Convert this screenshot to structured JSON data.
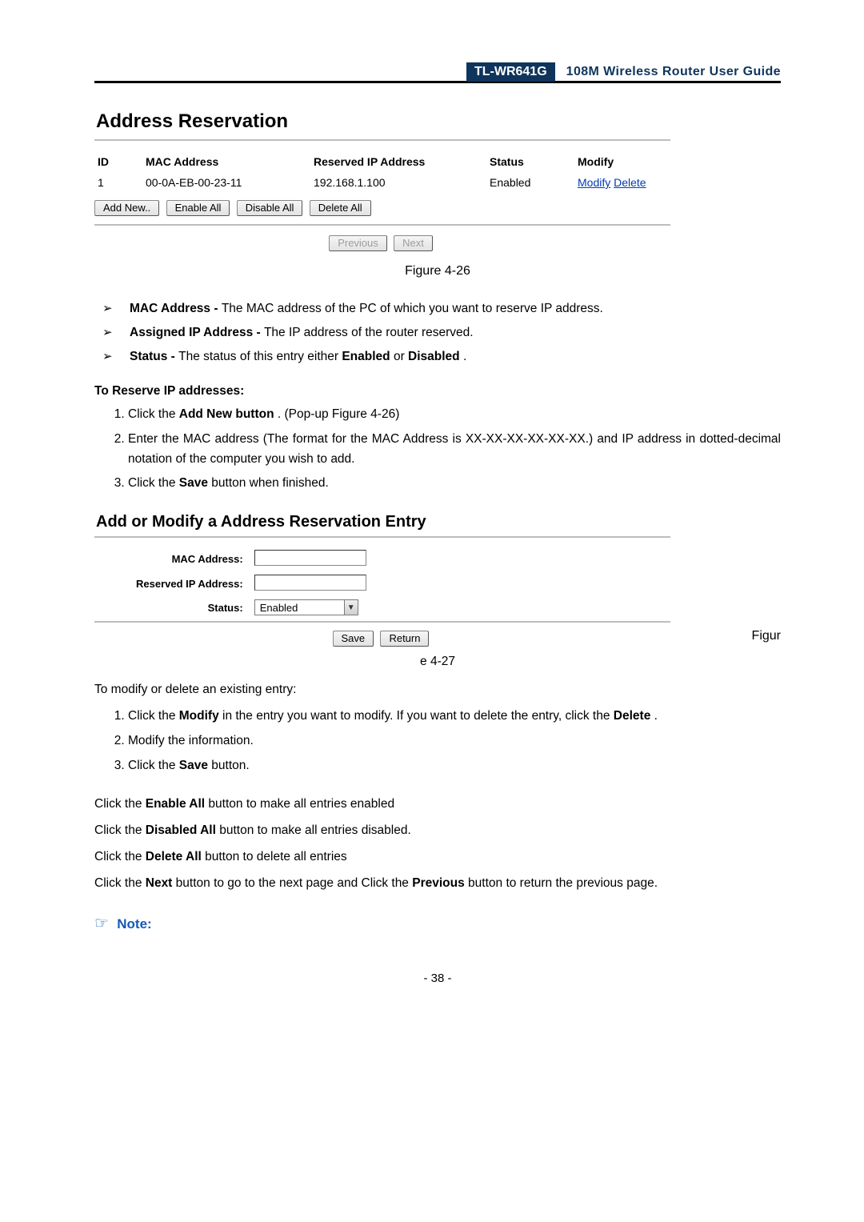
{
  "header": {
    "model": "TL-WR641G",
    "title": "108M  Wireless  Router  User  Guide"
  },
  "figure1": {
    "heading": "Address Reservation",
    "columns": {
      "id": "ID",
      "mac": "MAC Address",
      "ip": "Reserved IP Address",
      "status": "Status",
      "modify": "Modify"
    },
    "row": {
      "id": "1",
      "mac": "00-0A-EB-00-23-11",
      "ip": "192.168.1.100",
      "status": "Enabled",
      "modify": "Modify",
      "delete": "Delete"
    },
    "buttons": {
      "add": "Add New..",
      "enable": "Enable All",
      "disable": "Disable All",
      "del": "Delete All",
      "prev": "Previous",
      "next": "Next"
    },
    "caption": "Figure 4-26"
  },
  "bullets": {
    "mac_b": "MAC Address - ",
    "mac_t": "The MAC address of the PC of which you want to reserve IP address.",
    "ip_b": "Assigned IP Address - ",
    "ip_t": "The IP address of the router reserved.",
    "st_b": "Status - ",
    "st_t": "The status of this entry either ",
    "st_en": "Enabled",
    "st_or": " or ",
    "st_di": "Disabled",
    "st_p": "."
  },
  "reserve": {
    "heading": "To Reserve IP addresses:",
    "s1a": "Click the ",
    "s1b": "Add New button",
    "s1c": ". (Pop-up Figure 4-26)",
    "s2": "Enter the MAC address (The format for the MAC Address is XX-XX-XX-XX-XX-XX.) and IP address in dotted-decimal notation of the computer you wish to add.",
    "s3a": "Click the ",
    "s3b": "Save",
    "s3c": " button when finished."
  },
  "figure2": {
    "heading": "Add or Modify a Address Reservation Entry",
    "mac_lbl": "MAC Address:",
    "ip_lbl": "Reserved IP Address:",
    "status_lbl": "Status:",
    "status_value": "Enabled",
    "save": "Save",
    "ret": "Return",
    "figur_side": "Figur",
    "caption": "e 4-27"
  },
  "modify": {
    "intro": "To modify or delete an existing entry:",
    "s1a": "Click the ",
    "s1b": "Modify",
    "s1c": " in the entry you want to modify. If you want to delete the entry, click the ",
    "s1d": "Delete",
    "s1e": ".",
    "s2": "Modify the information.",
    "s3a": "Click the ",
    "s3b": "Save",
    "s3c": " button."
  },
  "extras": {
    "l1a": "Click the ",
    "l1b": "Enable All",
    "l1c": " button to make all entries enabled",
    "l2a": "Click the ",
    "l2b": "Disabled All",
    "l2c": " button to make all entries disabled.",
    "l3a": "Click the ",
    "l3b": "Delete All",
    "l3c": " button to delete all entries",
    "l4a": "Click the ",
    "l4b": "Next",
    "l4c": " button to go to the next page and Click the ",
    "l4d": "Previous",
    "l4e": " button to return the previous page."
  },
  "note_lbl": "Note:",
  "page_num": "- 38 -"
}
